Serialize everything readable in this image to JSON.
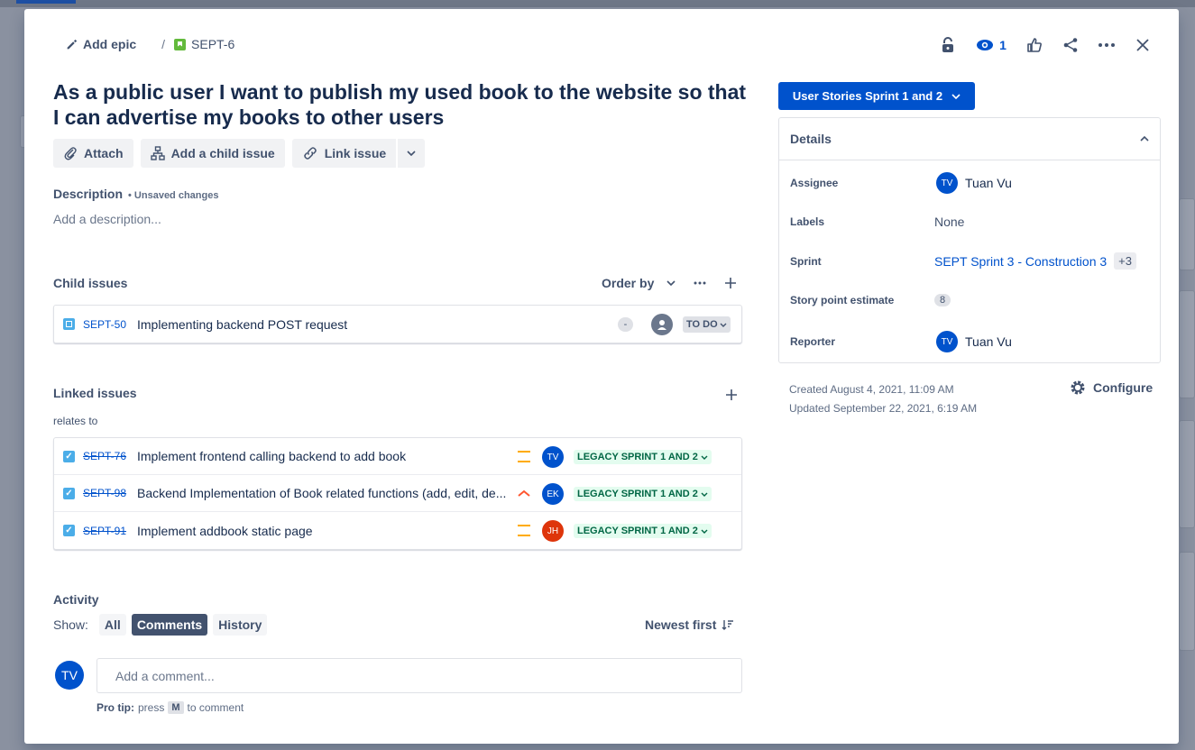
{
  "breadcrumb": {
    "epic_label": "Add epic",
    "separator": "/",
    "issue_key": "SEPT-6"
  },
  "top_actions": {
    "watch_count": "1"
  },
  "issue": {
    "title": "As a public user I want to publish my used book to the website so that I can advertise my books to other users"
  },
  "actions": {
    "attach": "Attach",
    "add_child": "Add a child issue",
    "link_issue": "Link issue"
  },
  "description": {
    "label": "Description",
    "unsaved": "• Unsaved changes",
    "placeholder": "Add a description..."
  },
  "child_issues": {
    "label": "Child issues",
    "order_by": "Order by",
    "items": [
      {
        "key": "SEPT-50",
        "summary": "Implementing backend POST request",
        "estimate": "-",
        "status": "TO DO"
      }
    ]
  },
  "linked_issues": {
    "label": "Linked issues",
    "relation": "relates to",
    "items": [
      {
        "key": "SEPT-76",
        "summary": "Implement frontend calling backend to add book",
        "priority": "medium",
        "assignee": "TV",
        "assignee_color": "#0052cc",
        "sprint": "LEGACY SPRINT 1 AND 2"
      },
      {
        "key": "SEPT-98",
        "summary": "Backend Implementation of Book related functions (add, edit, de...",
        "priority": "high",
        "assignee": "EK",
        "assignee_color": "#0052cc",
        "sprint": "LEGACY SPRINT 1 AND 2"
      },
      {
        "key": "SEPT-91",
        "summary": "Implement addbook static page",
        "priority": "medium",
        "assignee": "JH",
        "assignee_color": "#de350b",
        "sprint": "LEGACY SPRINT 1 AND 2"
      }
    ]
  },
  "activity": {
    "label": "Activity",
    "show_label": "Show:",
    "filters": [
      "All",
      "Comments",
      "History"
    ],
    "active_filter": "Comments",
    "sort": "Newest first",
    "comment_avatar": "TV",
    "comment_placeholder": "Add a comment...",
    "protip_bold": "Pro tip:",
    "protip_press": "press",
    "protip_key": "M",
    "protip_rest": "to comment"
  },
  "sidebar": {
    "status_button": "User Stories Sprint 1 and 2",
    "details_title": "Details",
    "assignee_label": "Assignee",
    "assignee_initials": "TV",
    "assignee_name": "Tuan Vu",
    "labels_label": "Labels",
    "labels_value": "None",
    "sprint_label": "Sprint",
    "sprint_value": "SEPT Sprint 3 - Construction 3",
    "sprint_more": "+3",
    "sp_label": "Story point estimate",
    "sp_value": "8",
    "reporter_label": "Reporter",
    "reporter_initials": "TV",
    "reporter_name": "Tuan Vu",
    "created": "Created August 4, 2021, 11:09 AM",
    "updated": "Updated September 22, 2021, 6:19 AM",
    "configure": "Configure"
  },
  "colors": {
    "brand": "#0052cc",
    "story": "#63ba3c",
    "subtask": "#4bade8",
    "done_lozenge_bg": "#e3fcef",
    "done_lozenge_text": "#006644"
  }
}
